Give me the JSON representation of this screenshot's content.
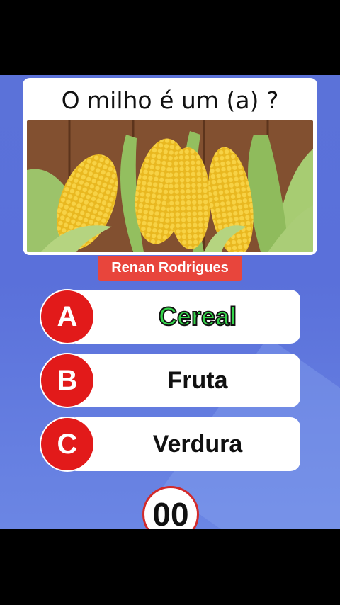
{
  "question": {
    "text": "O milho é um (a) ?"
  },
  "image": {
    "subject": "corn-image"
  },
  "credit": {
    "text": "Renan Rodrigues"
  },
  "options": [
    {
      "letter": "A",
      "text": "Cereal",
      "correct": true
    },
    {
      "letter": "B",
      "text": "Fruta",
      "correct": false
    },
    {
      "letter": "C",
      "text": "Verdura",
      "correct": false
    }
  ],
  "timer": {
    "value": "00"
  },
  "colors": {
    "background": "#5b72d9",
    "accent_red": "#e21a1a",
    "credit_badge": "#e8453c",
    "correct_text": "#34d44a"
  }
}
